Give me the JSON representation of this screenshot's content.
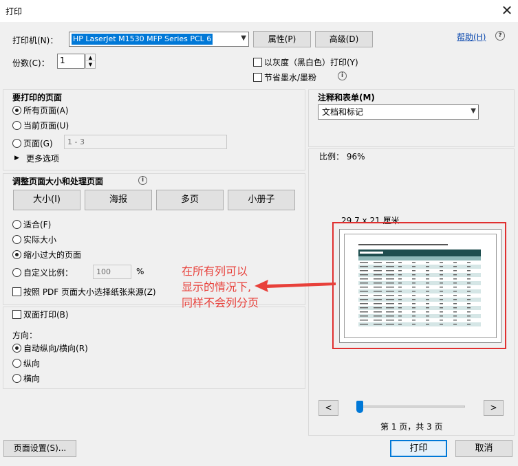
{
  "window": {
    "title": "打印",
    "close_glyph": "✕"
  },
  "printer": {
    "label": "打印机(N)：",
    "selected": "HP LaserJet M1530 MFP Series PCL 6",
    "properties_button": "属性(P)",
    "advanced_button": "高级(D)",
    "help_link": "帮助(H)",
    "help_icon": "?"
  },
  "copies": {
    "label": "份数(C)：",
    "value": "1"
  },
  "options": {
    "grayscale_label": "以灰度（黑白色）打印(Y)",
    "grayscale_checked": false,
    "save_ink_label": "节省墨水/墨粉",
    "save_ink_checked": false
  },
  "pages_to_print": {
    "title": "要打印的页面",
    "all_label": "所有页面(A)",
    "current_label": "当前页面(U)",
    "pages_label": "页面(G)",
    "pages_value": "1 - 3",
    "more_options": "更多选项",
    "selected": "all"
  },
  "sizing": {
    "title": "调整页面大小和处理页面",
    "buttons": [
      "大小(I)",
      "海报",
      "多页",
      "小册子"
    ],
    "fit_label": "适合(F)",
    "actual_label": "实际大小",
    "shrink_label": "缩小过大的页面",
    "custom_label": "自定义比例：",
    "custom_value": "100",
    "custom_unit": "%",
    "selected": "shrink",
    "paper_source_label": "按照 PDF 页面大小选择纸张来源(Z)",
    "paper_source_checked": false
  },
  "duplex": {
    "label": "双面打印(B)",
    "checked": false
  },
  "orientation": {
    "title": "方向：",
    "auto_label": "自动纵向/横向(R)",
    "portrait_label": "纵向",
    "landscape_label": "横向",
    "selected": "auto"
  },
  "comments": {
    "title": "注释和表单(M)",
    "selected": "文档和标记"
  },
  "preview": {
    "scale_text": "比例： 96%",
    "paper_size": "29.7 x 21 厘米",
    "page_indicator": "第 1 页，共 3 页",
    "prev": "<",
    "next": ">",
    "current_page": 1,
    "total_pages": 3
  },
  "annotation": {
    "lines": [
      "在所有列可以",
      "显示的情况下,",
      "同样不会列分页"
    ],
    "color": "#e8403a"
  },
  "footer": {
    "page_setup": "页面设置(S)...",
    "print": "打印",
    "cancel": "取消"
  },
  "colors": {
    "accent": "#0078d7",
    "highlight_border": "#e03030",
    "table_header": "#1f4e4f"
  }
}
